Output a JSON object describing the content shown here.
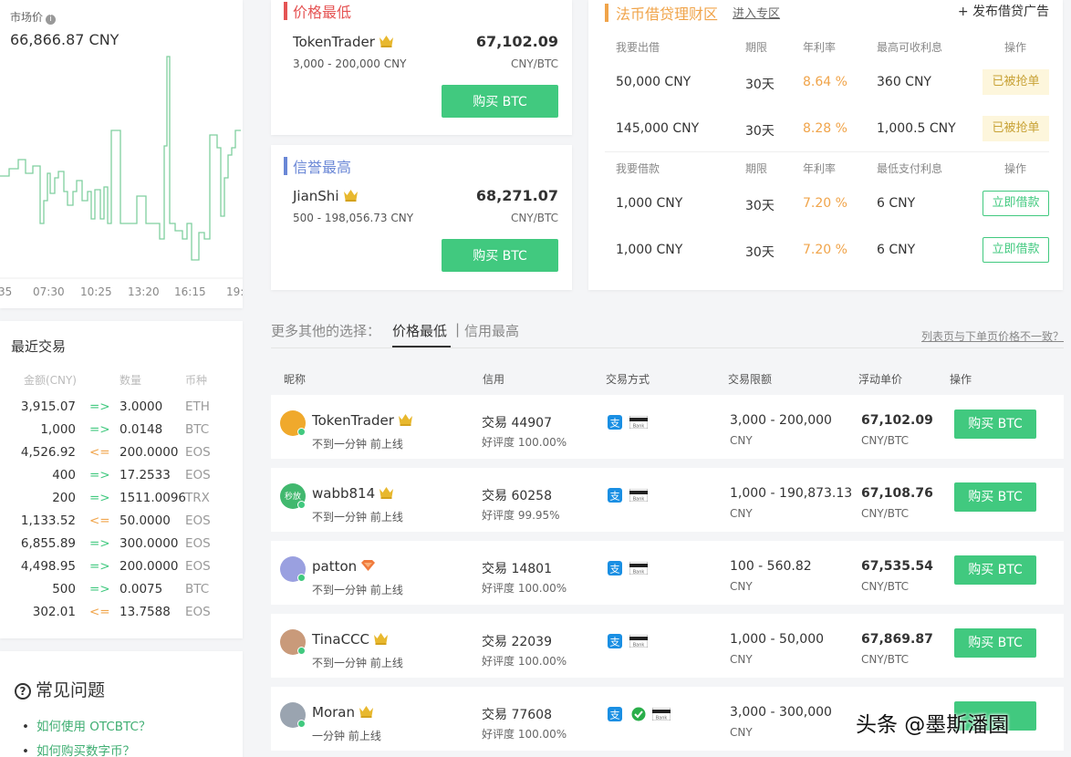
{
  "market": {
    "label": "市场价",
    "price": "66,866.87 CNY",
    "x_ticks": [
      "35",
      "07:30",
      "10:25",
      "13:20",
      "16:15",
      "19:"
    ]
  },
  "recent": {
    "title": "最近交易",
    "headers": [
      "金额(CNY)",
      "数量",
      "币种"
    ],
    "rows": [
      {
        "amount": "3,915.07",
        "arrow": "=>",
        "qty": "3.0000",
        "coin": "ETH"
      },
      {
        "amount": "1,000",
        "arrow": "=>",
        "qty": "0.0148",
        "coin": "BTC"
      },
      {
        "amount": "4,526.92",
        "arrow": "<=",
        "qty": "200.0000",
        "coin": "EOS"
      },
      {
        "amount": "400",
        "arrow": "=>",
        "qty": "17.2533",
        "coin": "EOS"
      },
      {
        "amount": "200",
        "arrow": "=>",
        "qty": "1511.0096",
        "coin": "TRX"
      },
      {
        "amount": "1,133.52",
        "arrow": "<=",
        "qty": "50.0000",
        "coin": "EOS"
      },
      {
        "amount": "6,855.89",
        "arrow": "=>",
        "qty": "300.0000",
        "coin": "EOS"
      },
      {
        "amount": "4,498.95",
        "arrow": "=>",
        "qty": "200.0000",
        "coin": "EOS"
      },
      {
        "amount": "500",
        "arrow": "=>",
        "qty": "0.0075",
        "coin": "BTC"
      },
      {
        "amount": "302.01",
        "arrow": "<=",
        "qty": "13.7588",
        "coin": "EOS"
      }
    ]
  },
  "faq": {
    "title": "常见问题",
    "items": [
      "如何使用 OTCBTC？",
      "如何购买数字币？"
    ]
  },
  "price_low": {
    "title": "价格最低",
    "name": "TokenTrader",
    "range": "3,000 - 200,000 CNY",
    "price": "67,102.09",
    "unit": "CNY/BTC",
    "button": "购买 BTC"
  },
  "credit_high": {
    "title": "信誉最高",
    "name": "JianShi",
    "range": "500 - 198,056.73 CNY",
    "price": "68,271.07",
    "unit": "CNY/BTC",
    "button": "购买 BTC"
  },
  "loan": {
    "title": "法币借贷理财区",
    "enter": "进入专区",
    "publish": "+ 发布借贷广告",
    "lend_headers": [
      "我要出借",
      "期限",
      "年利率",
      "最高可收利息",
      "操作"
    ],
    "lend_rows": [
      {
        "amount": "50,000 CNY",
        "term": "30天",
        "rate": "8.64 %",
        "interest": "360 CNY",
        "action": "已被抢单"
      },
      {
        "amount": "145,000 CNY",
        "term": "30天",
        "rate": "8.28 %",
        "interest": "1,000.5 CNY",
        "action": "已被抢单"
      }
    ],
    "borrow_headers": [
      "我要借款",
      "期限",
      "年利率",
      "最低支付利息",
      "操作"
    ],
    "borrow_rows": [
      {
        "amount": "1,000 CNY",
        "term": "30天",
        "rate": "7.20 %",
        "interest": "6 CNY",
        "action": "立即借款"
      },
      {
        "amount": "1,000 CNY",
        "term": "30天",
        "rate": "7.20 %",
        "interest": "6 CNY",
        "action": "立即借款"
      }
    ]
  },
  "tabs": {
    "more_label": "更多其他的选择：",
    "price_low": "价格最低",
    "sep": "|",
    "credit_high": "信用最高",
    "mismatch": "列表页与下单页价格不一致？"
  },
  "table": {
    "headers": [
      "昵称",
      "信用",
      "交易方式",
      "交易限额",
      "浮动单价",
      "操作"
    ],
    "bank_label": "Bank",
    "rows": [
      {
        "name": "TokenTrader",
        "badge": "crown",
        "online": "不到一分钟 前上线",
        "trades": "交易 44907",
        "good": "好评度 100.00%",
        "limit": "3,000 - 200,000",
        "currency": "CNY",
        "price": "67,102.09",
        "unit": "CNY/BTC",
        "button": "购买 BTC",
        "wechat": false
      },
      {
        "name": "wabb814",
        "badge": "crown",
        "avatar_text": "秒放",
        "online": "不到一分钟 前上线",
        "trades": "交易 60258",
        "good": "好评度 99.95%",
        "limit": "1,000 - 190,873.13",
        "currency": "CNY",
        "price": "67,108.76",
        "unit": "CNY/BTC",
        "button": "购买 BTC",
        "wechat": false
      },
      {
        "name": "patton",
        "badge": "diamond",
        "online": "不到一分钟 前上线",
        "trades": "交易 14801",
        "good": "好评度 100.00%",
        "limit": "100 - 560.82",
        "currency": "CNY",
        "price": "67,535.54",
        "unit": "CNY/BTC",
        "button": "购买 BTC",
        "wechat": false
      },
      {
        "name": "TinaCCC",
        "badge": "crown",
        "online": "不到一分钟 前上线",
        "trades": "交易 22039",
        "good": "好评度 100.00%",
        "limit": "1,000 - 50,000",
        "currency": "CNY",
        "price": "67,869.87",
        "unit": "CNY/BTC",
        "button": "购买 BTC",
        "wechat": false
      },
      {
        "name": "Moran",
        "badge": "crown",
        "online": "一分钟 前上线",
        "trades": "交易 77608",
        "good": "好评度 100.00%",
        "limit": "3,000 - 300,000",
        "currency": "CNY",
        "price": "",
        "unit": "",
        "button": "",
        "wechat": true
      }
    ]
  },
  "watermark": "头条 @墨斯潘園"
}
